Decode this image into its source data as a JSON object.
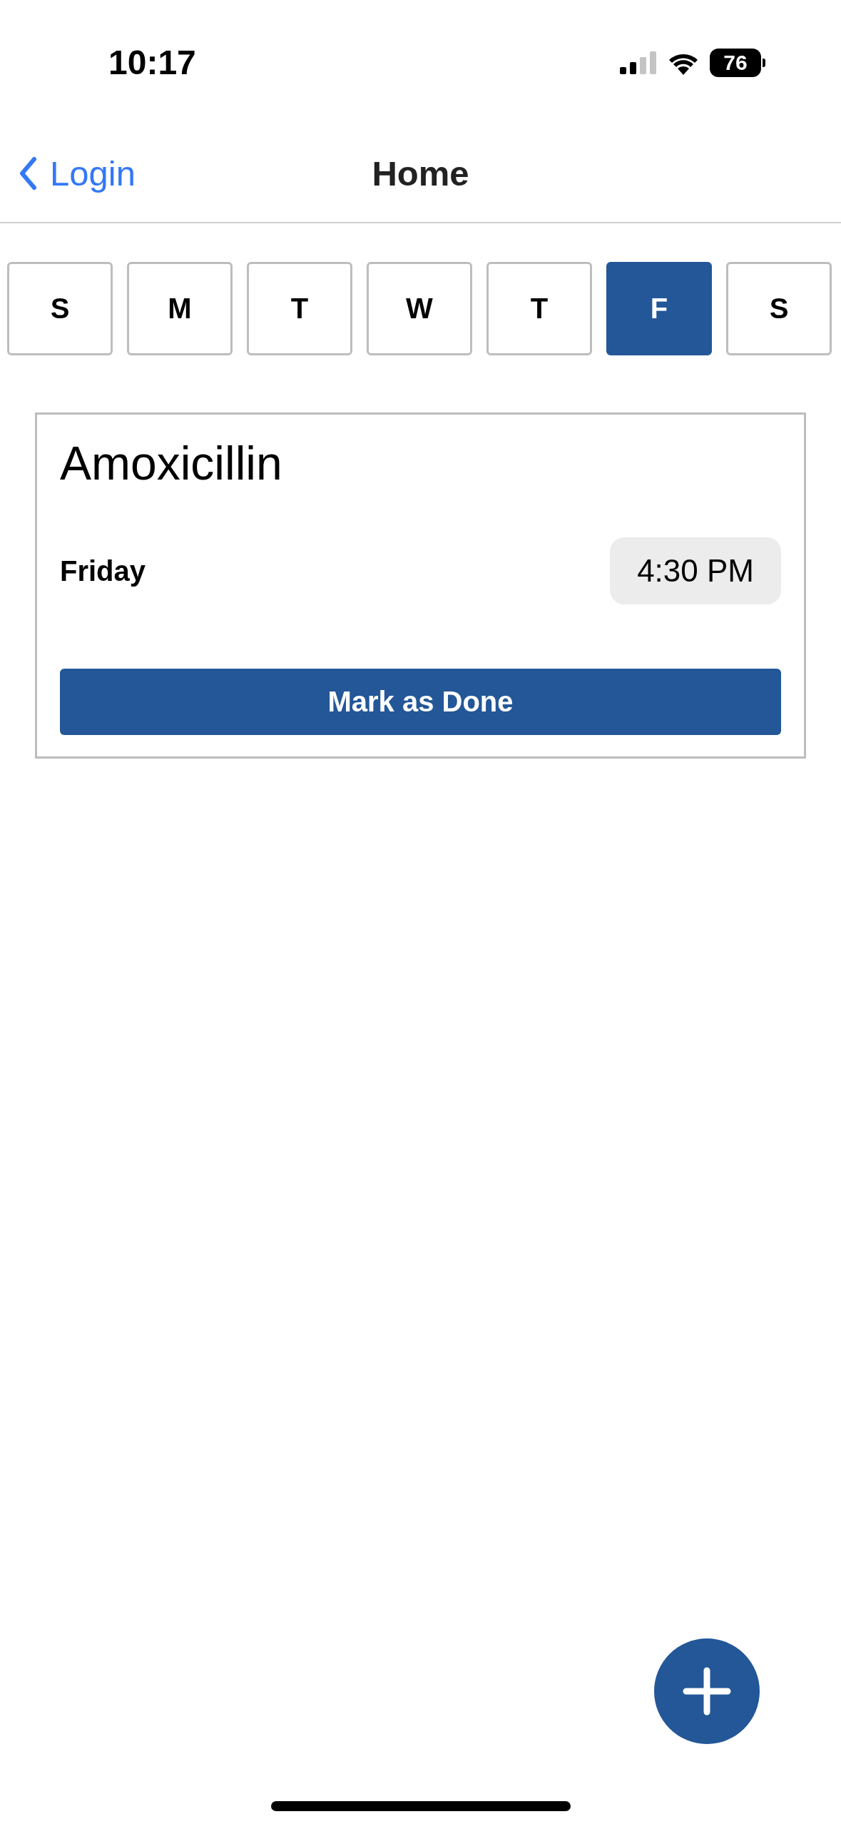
{
  "status_bar": {
    "time": "10:17",
    "battery": "76"
  },
  "nav": {
    "back_label": "Login",
    "title": "Home"
  },
  "days": [
    {
      "label": "S",
      "selected": false
    },
    {
      "label": "M",
      "selected": false
    },
    {
      "label": "T",
      "selected": false
    },
    {
      "label": "W",
      "selected": false
    },
    {
      "label": "T",
      "selected": false
    },
    {
      "label": "F",
      "selected": true
    },
    {
      "label": "S",
      "selected": false
    }
  ],
  "reminders": [
    {
      "name": "Amoxicillin",
      "day": "Friday",
      "time": "4:30 PM",
      "action": "Mark as Done"
    }
  ]
}
